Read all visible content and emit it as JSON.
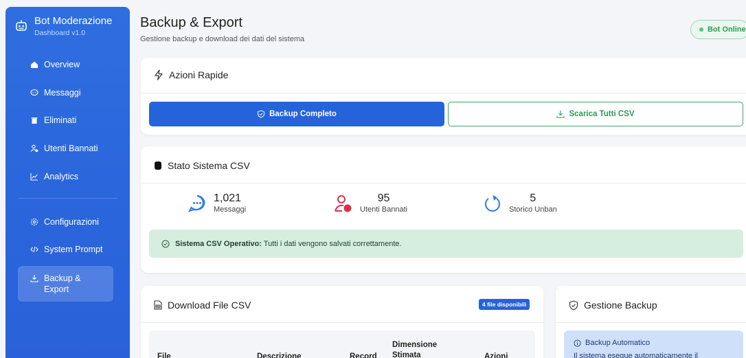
{
  "sidebar": {
    "brand_title": "Bot Moderazione",
    "brand_subtitle": "Dashboard v1.0",
    "items": [
      {
        "label": "Overview",
        "icon": "home-icon"
      },
      {
        "label": "Messaggi",
        "icon": "chat-bubble-icon"
      },
      {
        "label": "Eliminati",
        "icon": "trash-icon"
      },
      {
        "label": "Utenti Bannati",
        "icon": "user-ban-icon"
      },
      {
        "label": "Analytics",
        "icon": "chart-line-icon"
      },
      {
        "label": "Configurazioni",
        "icon": "gear-icon"
      },
      {
        "label": "System Prompt",
        "icon": "code-icon"
      },
      {
        "label": "Backup & Export",
        "icon": "download-icon",
        "active": true
      }
    ]
  },
  "header": {
    "title": "Backup & Export",
    "subtitle": "Gestione backup e download dei dati del sistema",
    "status": "Bot Online",
    "status_color": "#2c9b52"
  },
  "quick_actions": {
    "title": "Azioni Rapide",
    "backup_button": "Backup Completo",
    "csv_button": "Scarica Tutti CSV"
  },
  "csv_status": {
    "title": "Stato Sistema CSV",
    "stats": [
      {
        "value": "1,021",
        "label": "Messaggi",
        "icon": "chat-icon",
        "color": "#2a7de1"
      },
      {
        "value": "95",
        "label": "Utenti Bannati",
        "icon": "user-ban-icon",
        "color": "#d9304a"
      },
      {
        "value": "5",
        "label": "Storico Unban",
        "icon": "refresh-icon",
        "color": "#2a7de1"
      }
    ],
    "alert_bold": "Sistema CSV Operativo:",
    "alert_text": " Tutti i dati vengono salvati correttamente."
  },
  "download": {
    "title": "Download File CSV",
    "badge": "4 file disponibili",
    "columns": [
      "File",
      "Descrizione",
      "Record",
      "Dimensione Stimata",
      "Azioni"
    ]
  },
  "backup_mgmt": {
    "title": "Gestione Backup",
    "info_title": "Backup Automatico",
    "info_text": "Il sistema esegue automaticamente il"
  },
  "colors": {
    "primary": "#2563da",
    "success": "#2a9a55",
    "danger": "#d9304a"
  }
}
